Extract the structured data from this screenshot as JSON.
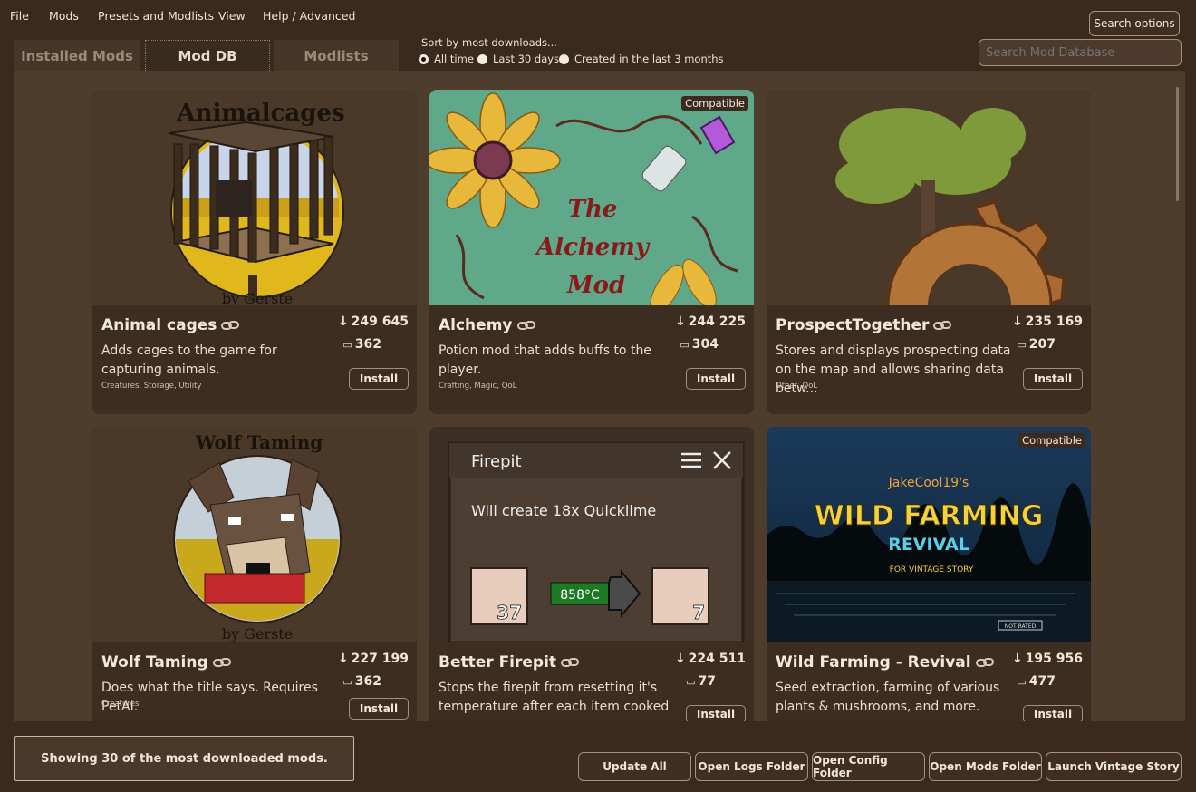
{
  "menu": [
    "File",
    "Mods",
    "Presets and Modlists",
    "View",
    "Help / Advanced"
  ],
  "tabs": [
    {
      "label": "Installed Mods",
      "active": false
    },
    {
      "label": "Mod DB",
      "active": true
    },
    {
      "label": "Modlists",
      "active": false
    }
  ],
  "sort": {
    "title": "Sort by most downloads...",
    "options": [
      {
        "label": "All time",
        "checked": true
      },
      {
        "label": "Last 30 days",
        "checked": false
      },
      {
        "label": "Created in the last 3 months",
        "checked": false
      }
    ]
  },
  "search": {
    "options_label": "Search options",
    "placeholder": "Search Mod Database"
  },
  "mods": [
    {
      "name": "Animal cages",
      "downloads": "249 645",
      "comments": "362",
      "desc": "Adds cages to the game for capturing animals.",
      "tags": "Creatures, Storage, Utility",
      "install_label": "Install",
      "badge": "",
      "art": {
        "title": "Animalcages",
        "credit": "by Gerste"
      }
    },
    {
      "name": "Alchemy",
      "downloads": "244 225",
      "comments": "304",
      "desc": "Potion mod that adds buffs to the player.",
      "tags": "Crafting, Magic, QoL",
      "install_label": "Install",
      "badge": "Compatible",
      "art": {
        "line1": "The",
        "line2": "Alchemy",
        "line3": "Mod"
      }
    },
    {
      "name": "ProspectTogether",
      "downloads": "235 169",
      "comments": "207",
      "desc": "Stores and displays prospecting data on the map and allows sharing data betw...",
      "tags": "Other, QoL",
      "install_label": "Install",
      "badge": ""
    },
    {
      "name": "Wolf Taming",
      "downloads": "227 199",
      "comments": "362",
      "desc": "Does what the title says. Requires PetAI.",
      "tags": "Creatures",
      "install_label": "Install",
      "badge": "",
      "art": {
        "title": "Wolf Taming",
        "credit": "by Gerste"
      }
    },
    {
      "name": "Better Firepit",
      "downloads": "224 511",
      "comments": "77",
      "desc": "Stops the firepit from resetting it's temperature after each item cooked",
      "tags": "",
      "install_label": "Install",
      "badge": "",
      "art": {
        "window_title": "Firepit",
        "message": "Will create 18x Quicklime",
        "temperature": "858°C",
        "input_count": "37",
        "output_count": "7"
      }
    },
    {
      "name": "Wild Farming - Revival",
      "downloads": "195 956",
      "comments": "477",
      "desc": "Seed extraction, farming of various plants & mushrooms, and more.",
      "tags": "",
      "install_label": "Install",
      "badge": "Compatible",
      "art": {
        "author": "JakeCool19's",
        "title1": "WILD FARMING",
        "title2": "REVIVAL",
        "subtitle": "FOR VINTAGE STORY",
        "rating": "NOT RATED"
      }
    }
  ],
  "status_text": "Showing 30 of the most downloaded mods.",
  "buttons": {
    "update_all": "Update All",
    "open_logs": "Open Logs Folder",
    "open_config": "Open Config Folder",
    "open_mods": "Open Mods Folder",
    "launch": "Launch Vintage Story"
  },
  "colors": {
    "background": "#3a2a1e",
    "panel": "#4e3c2c",
    "card": "#3d2d20",
    "accent_border": "#a59077"
  }
}
